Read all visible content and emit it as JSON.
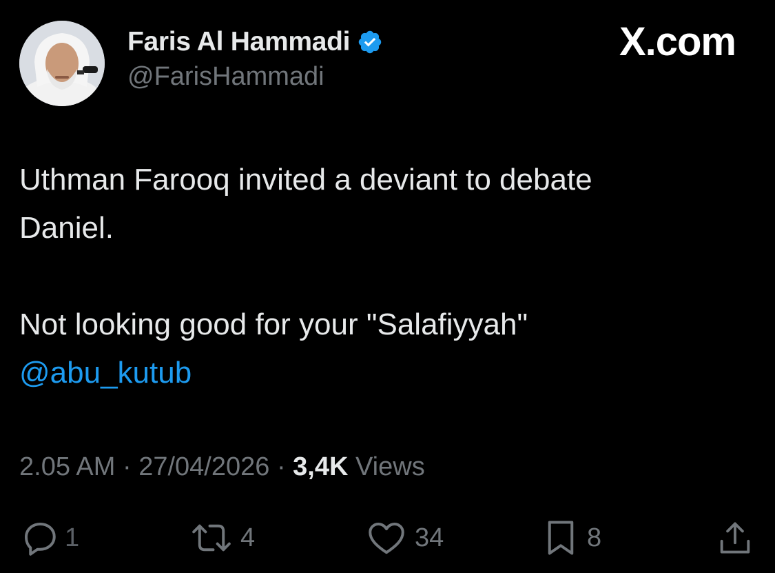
{
  "tweet": {
    "author": {
      "display_name": "Faris Al Hammadi",
      "handle": "@FarisHammadi",
      "verified": true
    },
    "brand": "X.com",
    "text_lines": [
      "Uthman Farooq invited a deviant to debate",
      "Daniel.",
      "Not looking good for your \"Salafiyyah\""
    ],
    "mention": "@abu_kutub",
    "time": "2.05 AM",
    "separator": "·",
    "date": "27/04/2026",
    "views_count": "3,4K",
    "views_label": "Views",
    "stats": {
      "replies": "1",
      "retweets": "4",
      "likes": "34",
      "bookmarks": "8"
    }
  },
  "colors": {
    "background": "#000000",
    "text_primary": "#e7e9ea",
    "text_secondary": "#71767b",
    "accent": "#1d9bf0"
  },
  "icons": [
    "verified-badge-icon",
    "reply-icon",
    "retweet-icon",
    "like-icon",
    "bookmark-icon",
    "share-icon"
  ]
}
